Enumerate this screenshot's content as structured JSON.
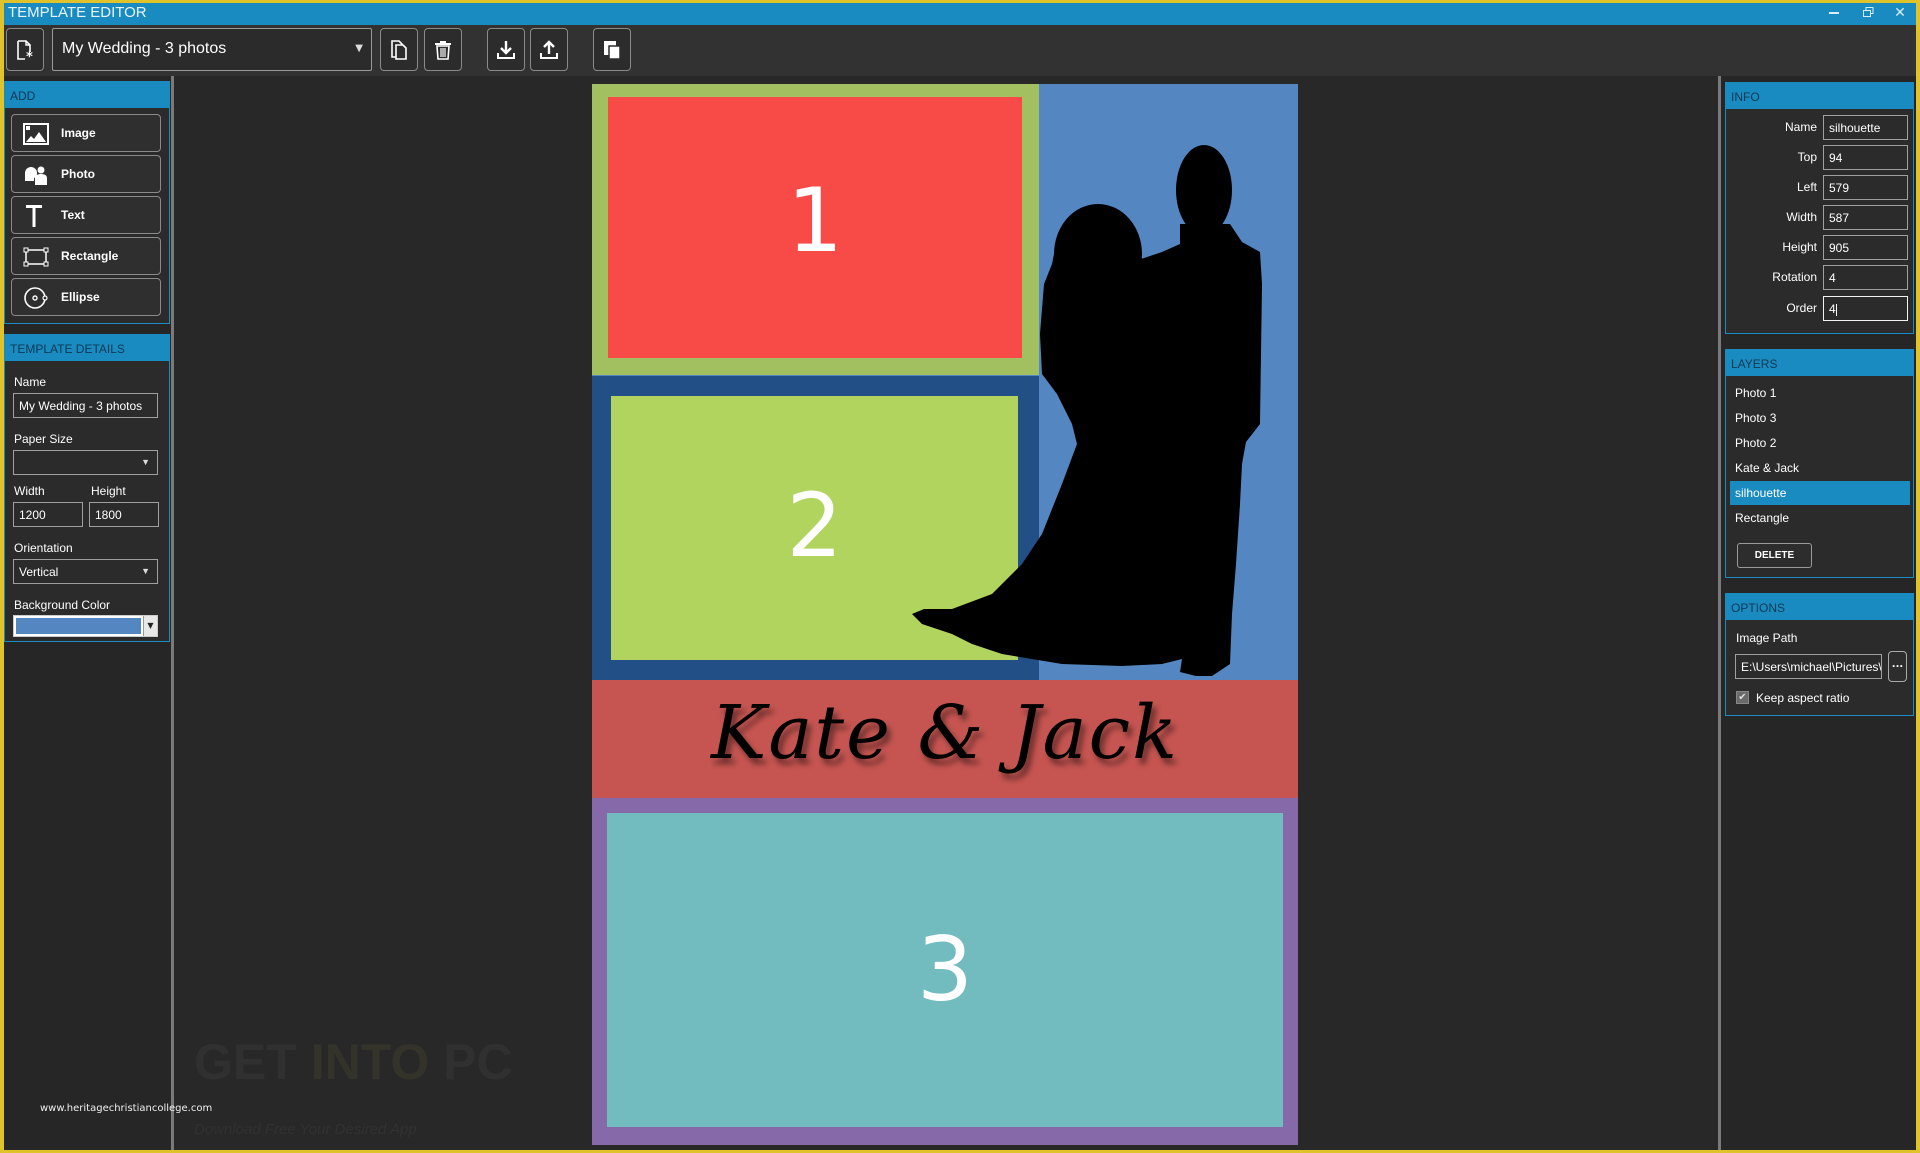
{
  "window": {
    "title": "TEMPLATE EDITOR",
    "controls": {
      "minimize": "minimize-icon",
      "restore": "restore-icon",
      "close": "close-icon"
    }
  },
  "toolbar": {
    "template_selector": {
      "value": "My Wedding - 3 photos"
    },
    "buttons": [
      {
        "name": "new-template",
        "icon": "new-document-icon"
      },
      {
        "name": "duplicate-template",
        "icon": "copy-icon"
      },
      {
        "name": "delete-template",
        "icon": "trash-icon"
      },
      {
        "name": "import-template",
        "icon": "download-icon"
      },
      {
        "name": "export-template",
        "icon": "upload-icon"
      },
      {
        "name": "layers",
        "icon": "stack-icon"
      }
    ]
  },
  "add_panel": {
    "header": "ADD",
    "items": [
      {
        "label": "Image",
        "icon": "image-icon"
      },
      {
        "label": "Photo",
        "icon": "photo-people-icon"
      },
      {
        "label": "Text",
        "icon": "text-icon"
      },
      {
        "label": "Rectangle",
        "icon": "rectangle-icon"
      },
      {
        "label": "Ellipse",
        "icon": "ellipse-icon"
      }
    ]
  },
  "template_details": {
    "header": "TEMPLATE DETAILS",
    "name_label": "Name",
    "name_value": "My Wedding - 3 photos",
    "paper_size_label": "Paper Size",
    "paper_size_value": "",
    "width_label": "Width",
    "width_value": "1200",
    "height_label": "Height",
    "height_value": "1800",
    "orientation_label": "Orientation",
    "orientation_value": "Vertical",
    "background_color_label": "Background Color",
    "background_color_value": "#5486c2"
  },
  "info": {
    "header": "INFO",
    "fields": [
      {
        "label": "Name",
        "value": "silhouette"
      },
      {
        "label": "Top",
        "value": "94"
      },
      {
        "label": "Left",
        "value": "579"
      },
      {
        "label": "Width",
        "value": "587"
      },
      {
        "label": "Height",
        "value": "905"
      },
      {
        "label": "Rotation",
        "value": "4"
      },
      {
        "label": "Order",
        "value": "4"
      }
    ]
  },
  "layers": {
    "header": "LAYERS",
    "items": [
      "Photo 1",
      "Photo 3",
      "Photo 2",
      "Kate & Jack",
      "silhouette",
      "Rectangle"
    ],
    "selected": "silhouette",
    "delete_label": "DELETE"
  },
  "options": {
    "header": "OPTIONS",
    "image_path_label": "Image Path",
    "image_path_value": "E:\\Users\\michael\\Pictures\\",
    "browse_label": "...",
    "keep_aspect_label": "Keep aspect ratio",
    "keep_aspect_checked": true
  },
  "canvas": {
    "background_color": "#5486c2",
    "photo_1": {
      "label": "1",
      "frame_color": "#a3c060",
      "fill_color": "#f84a46"
    },
    "photo_2": {
      "label": "2",
      "frame_color": "#234f87",
      "fill_color": "#b0d45e"
    },
    "banner": {
      "text": "Kate & Jack",
      "color": "#c65551"
    },
    "photo_3": {
      "label": "3",
      "frame_color": "#8669a8",
      "fill_color": "#72bbbf"
    },
    "silhouette": {
      "name": "silhouette",
      "color": "#000000"
    }
  },
  "watermark": {
    "logo_part1": "GET ",
    "logo_part2": "INTO",
    "logo_part3": " PC",
    "tagline": "Download Free Your Desired App",
    "url": "www.heritagechristiancollege.com"
  }
}
